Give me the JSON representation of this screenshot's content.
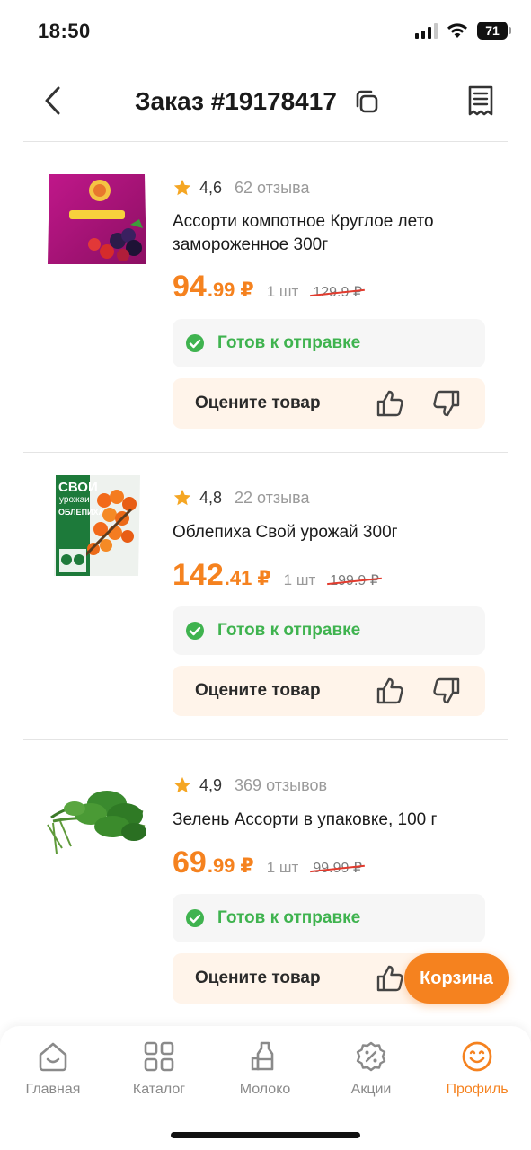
{
  "status_bar": {
    "time": "18:50",
    "battery": "71"
  },
  "header": {
    "title": "Заказ #19178417"
  },
  "products": [
    {
      "rating": "4,6",
      "reviews": "62 отзыва",
      "name": "Ассорти компотное Круглое лето замороженное 300г",
      "price_int": "94",
      "price_frac": ".99",
      "currency": "₽",
      "qty": "1 шт",
      "old_price": "129.9 ₽",
      "status": "Готов к отправке",
      "rate_label": "Оцените товар"
    },
    {
      "rating": "4,8",
      "reviews": "22 отзыва",
      "name": "Облепиха Свой урожай 300г",
      "price_int": "142",
      "price_frac": ".41",
      "currency": "₽",
      "qty": "1 шт",
      "old_price": "199.9 ₽",
      "status": "Готов к отправке",
      "rate_label": "Оцените товар",
      "package_text": {
        "brand": "СВОИ",
        "sub": "урожаи",
        "product": "ОБЛЕПИХА"
      }
    },
    {
      "rating": "4,9",
      "reviews": "369 отзывов",
      "name": "Зелень Ассорти в упаковке, 100 г",
      "price_int": "69",
      "price_frac": ".99",
      "currency": "₽",
      "qty": "1 шт",
      "old_price": "99.99 ₽",
      "status": "Готов к отправке",
      "rate_label": "Оцените товар"
    }
  ],
  "cart_button": "Корзина",
  "tabs": [
    {
      "label": "Главная",
      "icon": "home-icon",
      "active": false
    },
    {
      "label": "Каталог",
      "icon": "catalog-icon",
      "active": false
    },
    {
      "label": "Молоко",
      "icon": "milk-icon",
      "active": false
    },
    {
      "label": "Акции",
      "icon": "discount-icon",
      "active": false
    },
    {
      "label": "Профиль",
      "icon": "profile-icon",
      "active": true
    }
  ],
  "colors": {
    "accent": "#f5821f",
    "success": "#3fb34f",
    "strike": "#e23b2e",
    "star": "#f5a623"
  }
}
